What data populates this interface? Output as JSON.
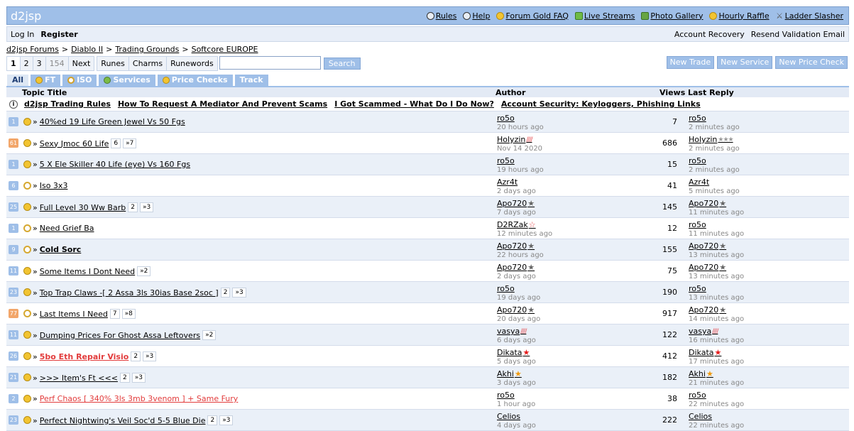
{
  "header": {
    "logo": "d2jsp",
    "links": [
      {
        "label": "Rules",
        "icon": "help-icon"
      },
      {
        "label": "Help",
        "icon": "help-icon"
      },
      {
        "label": "Forum Gold FAQ",
        "icon": "coin-icon"
      },
      {
        "label": "Live Streams",
        "icon": "live-icon"
      },
      {
        "label": "Photo Gallery",
        "icon": "camera-icon"
      },
      {
        "label": "Hourly Raffle",
        "icon": "coin-icon"
      },
      {
        "label": "Ladder Slasher",
        "icon": "sword-icon"
      }
    ]
  },
  "subbar": {
    "login": "Log In",
    "register": "Register",
    "account_recovery": "Account Recovery",
    "resend": "Resend Validation Email"
  },
  "breadcrumb": [
    "d2jsp Forums",
    ">",
    "Diablo II",
    ">",
    "Trading Grounds",
    ">",
    "Softcore EUROPE"
  ],
  "pager": {
    "pages": [
      "1",
      "2",
      "3",
      "154"
    ],
    "next": "Next",
    "filters": [
      "Runes",
      "Charms",
      "Runewords"
    ],
    "search_label": "Search"
  },
  "actions": [
    "New Trade",
    "New Service",
    "New Price Check"
  ],
  "tabs": [
    "All",
    "FT",
    "ISO",
    "Services",
    "Price Checks",
    "Track"
  ],
  "columns": {
    "topic": "Topic Title",
    "author": "Author",
    "views": "Views",
    "last": "Last Reply"
  },
  "sticky_links": [
    "d2jsp Trading Rules",
    "How To Request A Mediator And Prevent Scams",
    "I Got Scammed - What Do I Do Now?",
    "Account Security: Keyloggers, Phishing Links"
  ],
  "colors": {
    "accent": "#9fbfe8",
    "row_alt": "#eaf0f8",
    "hot": "#f2a66a",
    "red_title": "#e23b3b"
  },
  "topics": [
    {
      "count": "1",
      "type": "ft",
      "title": "40%ed 19 Life Green Jewel Vs 50 Fgs",
      "pages": [],
      "author": "ro5o",
      "author_badge": "",
      "author_time": "20 hours ago",
      "views": "7",
      "last": "ro5o",
      "last_badge": "",
      "last_time": "2 minutes ago"
    },
    {
      "count": "61",
      "type": "ft",
      "title": "Sexy Jmoc 60 Life",
      "pages": [
        "6",
        "»7"
      ],
      "author": "Holyzin",
      "author_badge": "////",
      "author_time": "Nov 14 2020",
      "views": "686",
      "last": "Holyzin",
      "last_badge": "★★★",
      "last_time": "2 minutes ago"
    },
    {
      "count": "1",
      "type": "ft",
      "title": "5 X Ele Skiller 40 Life (eye) Vs 160 Fgs",
      "pages": [],
      "author": "ro5o",
      "author_badge": "",
      "author_time": "19 hours ago",
      "views": "15",
      "last": "ro5o",
      "last_badge": "",
      "last_time": "2 minutes ago"
    },
    {
      "count": "6",
      "type": "iso",
      "title": "Iso 3x3",
      "pages": [],
      "author": "Azr4t",
      "author_badge": "",
      "author_time": "2 days ago",
      "views": "41",
      "last": "Azr4t",
      "last_badge": "",
      "last_time": "5 minutes ago"
    },
    {
      "count": "25",
      "type": "ft",
      "title": "Full Level 30 Ww Barb",
      "pages": [
        "2",
        "»3"
      ],
      "author": "Apo720",
      "author_badge": "★",
      "author_time": "7 days ago",
      "views": "145",
      "last": "Apo720",
      "last_badge": "★",
      "last_time": "11 minutes ago"
    },
    {
      "count": "1",
      "type": "iso",
      "title": "Need Grief Ba",
      "pages": [],
      "author": "D2RZak",
      "author_badge": "☆",
      "author_time": "12 minutes ago",
      "views": "12",
      "last": "ro5o",
      "last_badge": "",
      "last_time": "11 minutes ago"
    },
    {
      "count": "9",
      "type": "iso",
      "title": "Cold Sorc",
      "pages": [],
      "author": "Apo720",
      "author_badge": "★",
      "author_time": "22 hours ago",
      "views": "155",
      "last": "Apo720",
      "last_badge": "★",
      "last_time": "13 minutes ago",
      "style": "bold"
    },
    {
      "count": "11",
      "type": "ft",
      "title": "Some Items I Dont Need",
      "pages": [
        "»2"
      ],
      "author": "Apo720",
      "author_badge": "★",
      "author_time": "2 days ago",
      "views": "75",
      "last": "Apo720",
      "last_badge": "★",
      "last_time": "13 minutes ago"
    },
    {
      "count": "23",
      "type": "ft",
      "title": "Top Trap Claws -[ 2 Assa 3ls 30ias Base 2soc ]",
      "pages": [
        "2",
        "»3"
      ],
      "author": "ro5o",
      "author_badge": "",
      "author_time": "19 days ago",
      "views": "190",
      "last": "ro5o",
      "last_badge": "",
      "last_time": "13 minutes ago"
    },
    {
      "count": "77",
      "type": "iso",
      "title": "Last Items I Need",
      "pages": [
        "7",
        "»8"
      ],
      "author": "Apo720",
      "author_badge": "★",
      "author_time": "20 days ago",
      "views": "917",
      "last": "Apo720",
      "last_badge": "★",
      "last_time": "14 minutes ago"
    },
    {
      "count": "11",
      "type": "ft",
      "title": "Dumping Prices For Ghost Assa Leftovers",
      "pages": [
        "»2"
      ],
      "author": "vasya",
      "author_badge": "////",
      "author_time": "6 days ago",
      "views": "122",
      "last": "vasya",
      "last_badge": "////",
      "last_time": "16 minutes ago"
    },
    {
      "count": "26",
      "type": "ft",
      "title": "5bo Eth Repair Visio",
      "pages": [
        "2",
        "»3"
      ],
      "author": "Dikata",
      "author_badge": "★",
      "author_time": "5 days ago",
      "views": "412",
      "last": "Dikata",
      "last_badge": "★",
      "last_time": "17 minutes ago",
      "style": "redb"
    },
    {
      "count": "21",
      "type": "ft",
      "title": ">>> Item's Ft <<<",
      "pages": [
        "2",
        "»3"
      ],
      "author": "Akhi",
      "author_badge": "★",
      "author_time": "3 days ago",
      "views": "182",
      "last": "Akhi",
      "last_badge": "★",
      "last_time": "21 minutes ago"
    },
    {
      "count": "2",
      "type": "ft",
      "title": "Perf Chaos [ 340% 3ls 3mb 3venom ] + Same Fury",
      "pages": [],
      "author": "ro5o",
      "author_badge": "",
      "author_time": "1 hour ago",
      "views": "38",
      "last": "ro5o",
      "last_badge": "",
      "last_time": "22 minutes ago",
      "style": "red"
    },
    {
      "count": "23",
      "type": "ft",
      "title": "Perfect Nightwing's Veil Soc'd 5-5 Blue Die",
      "pages": [
        "2",
        "»3"
      ],
      "author": "Celios",
      "author_badge": "",
      "author_time": "4 days ago",
      "views": "222",
      "last": "Celios",
      "last_badge": "",
      "last_time": "22 minutes ago"
    }
  ]
}
